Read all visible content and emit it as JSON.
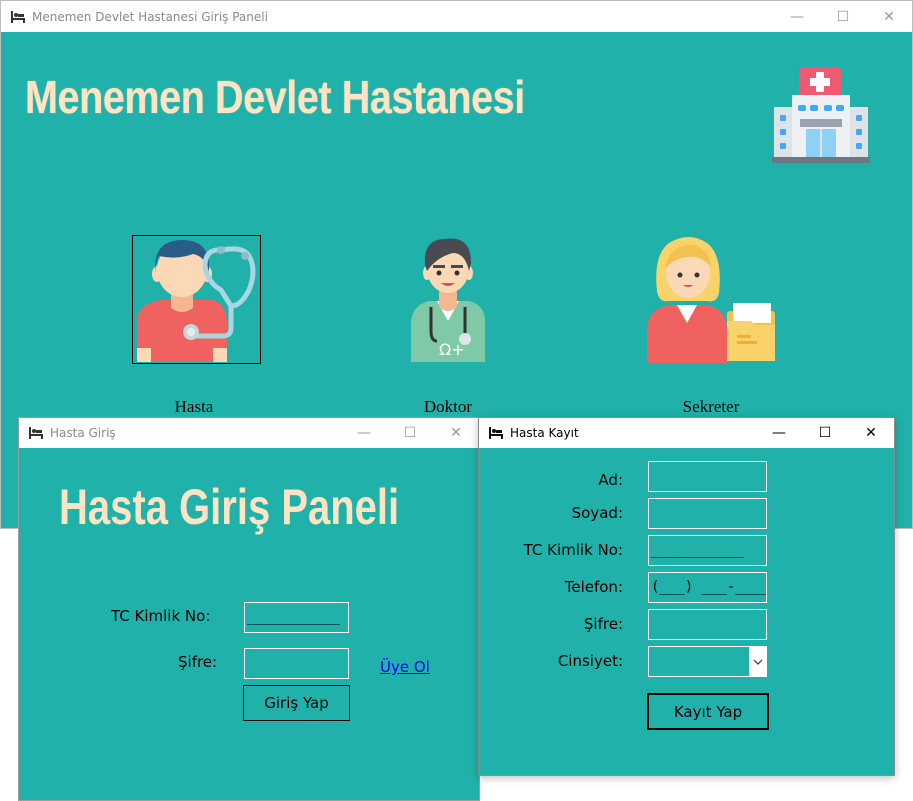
{
  "main_window": {
    "title": "Menemen Devlet Hastanesi Giriş Paneli",
    "heading": "Menemen Devlet Hastanesi",
    "roles": [
      {
        "label": "Hasta",
        "icon": "patient-icon",
        "selected": true
      },
      {
        "label": "Doktor",
        "icon": "doctor-icon",
        "selected": false
      },
      {
        "label": "Sekreter",
        "icon": "secretary-icon",
        "selected": false
      }
    ],
    "logo_icon": "hospital-building-icon"
  },
  "login_window": {
    "title": "Hasta Giriş",
    "heading": "Hasta Giriş Paneli",
    "tc_label": "TC Kimlik No:",
    "tc_value": "___________",
    "password_label": "Şifre:",
    "password_value": "",
    "submit_label": "Giriş Yap",
    "register_link": "Üye Ol"
  },
  "register_window": {
    "title": "Hasta Kayıt",
    "fields": [
      {
        "label": "Ad:",
        "value": ""
      },
      {
        "label": "Soyad:",
        "value": ""
      },
      {
        "label": "TC Kimlik No:",
        "value": "___________"
      },
      {
        "label": "Telefon:",
        "value": "(___) ___-____"
      },
      {
        "label": "Şifre:",
        "value": ""
      }
    ],
    "gender_label": "Cinsiyet:",
    "gender_value": "",
    "submit_label": "Kayıt Yap"
  },
  "colors": {
    "background": "#20b2aa",
    "heading": "#fde4c3",
    "link": "#0000ee"
  }
}
